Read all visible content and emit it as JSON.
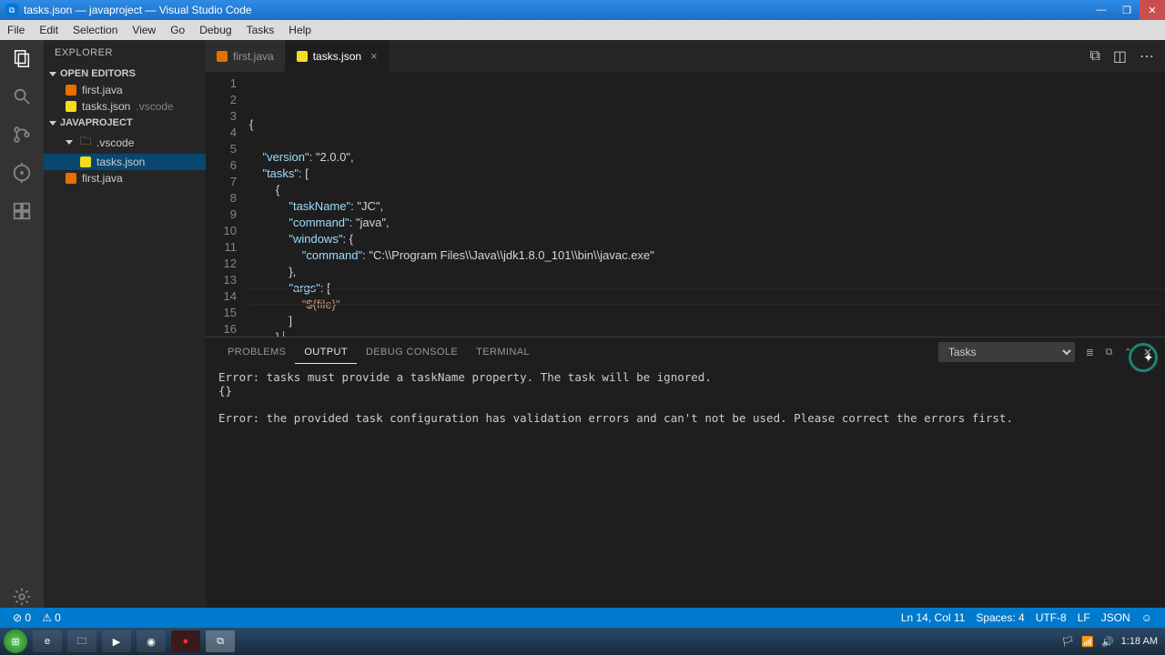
{
  "window": {
    "title": "tasks.json — javaproject — Visual Studio Code"
  },
  "menu": [
    "File",
    "Edit",
    "Selection",
    "View",
    "Go",
    "Debug",
    "Tasks",
    "Help"
  ],
  "sidebar": {
    "title": "EXPLORER",
    "openEditors": "OPEN EDITORS",
    "editors": [
      {
        "name": "first.java",
        "type": "java"
      },
      {
        "name": "tasks.json",
        "suffix": ".vscode",
        "type": "json"
      }
    ],
    "projectLabel": "JAVAPROJECT",
    "folder": ".vscode",
    "folderFiles": [
      {
        "name": "tasks.json",
        "type": "json"
      }
    ],
    "rootFiles": [
      {
        "name": "first.java",
        "type": "java"
      }
    ]
  },
  "tabs": [
    {
      "label": "first.java",
      "type": "java",
      "active": false
    },
    {
      "label": "tasks.json",
      "type": "json",
      "active": true
    }
  ],
  "code": {
    "lines": [
      "{",
      "",
      "    \"version\": \"2.0.0\",",
      "    \"tasks\": [",
      "        {",
      "            \"taskName\": \"JC\",",
      "            \"command\": \"java\",",
      "            \"windows\": {",
      "                \"command\": \"C:\\\\Program Files\\\\Java\\\\jdk1.8.0_101\\\\bin\\\\javac.exe\"",
      "            },",
      "            \"args\": [",
      "                \"${file}\"",
      "            ]",
      "        },",
      "        {",
      ""
    ],
    "lineNumbers": [
      "1",
      "2",
      "3",
      "4",
      "5",
      "6",
      "7",
      "8",
      "9",
      "10",
      "11",
      "12",
      "13",
      "14",
      "15",
      "16"
    ]
  },
  "panel": {
    "tabs": [
      "PROBLEMS",
      "OUTPUT",
      "DEBUG CONSOLE",
      "TERMINAL"
    ],
    "activeTab": 1,
    "select": "Tasks",
    "output": "Error: tasks must provide a taskName property. The task will be ignored.\n{}\n\nError: the provided task configuration has validation errors and can't not be used. Please correct the errors first."
  },
  "status": {
    "errors": "0",
    "warnings": "0",
    "cursor": "Ln 14, Col 11",
    "spaces": "Spaces: 4",
    "encoding": "UTF-8",
    "eol": "LF",
    "lang": "JSON",
    "smiley": "☺"
  },
  "tray": {
    "time": "1:18 AM",
    "date": ""
  }
}
